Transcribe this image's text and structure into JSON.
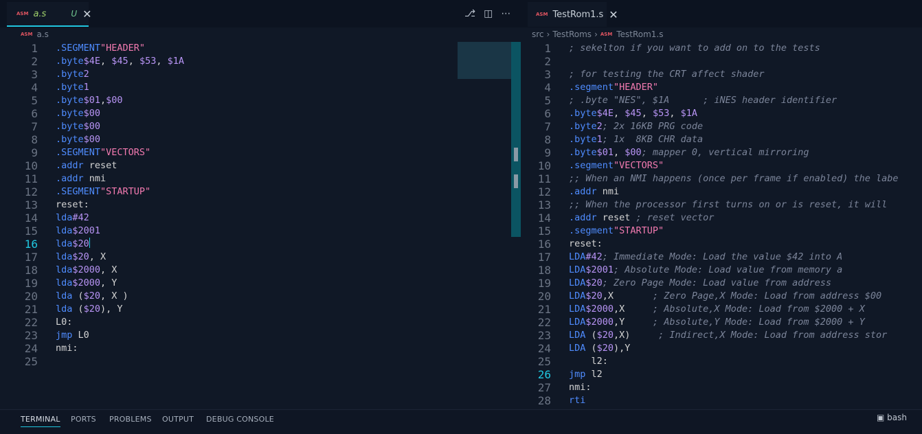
{
  "left_editor": {
    "tab": {
      "icon": "ASM",
      "filename": "a.s",
      "status": "U"
    },
    "breadcrumb": {
      "icon": "ASM",
      "file": "a.s"
    },
    "current_line": 16,
    "lines": [
      {
        "n": "1",
        "t": ".SEGMENT \"HEADER\""
      },
      {
        "n": "2",
        "t": "       .byte $4E, $45, $53, $1A"
      },
      {
        "n": "3",
        "t": "       .byte 2"
      },
      {
        "n": "4",
        "t": "       .byte 1"
      },
      {
        "n": "5",
        "t": "       .byte $01,$00"
      },
      {
        "n": "6",
        "t": "       .byte $00"
      },
      {
        "n": "7",
        "t": "       .byte $00"
      },
      {
        "n": "8",
        "t": "       .byte $00"
      },
      {
        "n": "9",
        "t": ".SEGMENT \"VECTORS\""
      },
      {
        "n": "10",
        "t": ".addr reset"
      },
      {
        "n": "11",
        "t": ".addr nmi"
      },
      {
        "n": "12",
        "t": ".SEGMENT \"STARTUP\""
      },
      {
        "n": "13",
        "t": "reset:"
      },
      {
        "n": "14",
        "t": "lda #42"
      },
      {
        "n": "15",
        "t": "lda $2001"
      },
      {
        "n": "16",
        "t": "lda $20"
      },
      {
        "n": "17",
        "t": "lda $20, X"
      },
      {
        "n": "18",
        "t": "lda $2000, X"
      },
      {
        "n": "19",
        "t": "lda $2000, Y"
      },
      {
        "n": "20",
        "t": "lda ($20, X )"
      },
      {
        "n": "21",
        "t": "lda ($20), Y"
      },
      {
        "n": "22",
        "t": "L0:"
      },
      {
        "n": "23",
        "t": "jmp L0"
      },
      {
        "n": "24",
        "t": "nmi:"
      },
      {
        "n": "25",
        "t": ""
      }
    ]
  },
  "right_editor": {
    "tab": {
      "icon": "ASM",
      "filename": "TestRom1.s"
    },
    "breadcrumb": {
      "parts": [
        "src",
        "TestRoms"
      ],
      "icon": "ASM",
      "file": "TestRom1.s"
    },
    "current_line": 26,
    "lines": [
      {
        "n": "1",
        "t": "; sekelton if you want to add on to the tests"
      },
      {
        "n": "2",
        "t": ""
      },
      {
        "n": "3",
        "t": "; for testing the CRT affect shader"
      },
      {
        "n": "4",
        "t": ".segment \"HEADER\""
      },
      {
        "n": "5",
        "t": "  ; .byte \"NES\", $1A      ; iNES header identifier"
      },
      {
        "n": "6",
        "t": "  .byte $4E, $45, $53, $1A"
      },
      {
        "n": "7",
        "t": "  .byte 2               ; 2x 16KB PRG code"
      },
      {
        "n": "8",
        "t": "  .byte 1               ; 1x  8KB CHR data"
      },
      {
        "n": "9",
        "t": "  .byte $01, $00        ; mapper 0, vertical mirroring"
      },
      {
        "n": "10",
        "t": ".segment \"VECTORS\""
      },
      {
        "n": "11",
        "t": "  ;; When an NMI happens (once per frame if enabled) the labe"
      },
      {
        "n": "12",
        "t": "    .addr nmi"
      },
      {
        "n": "13",
        "t": "    ;; When the processor first turns on or is reset, it will"
      },
      {
        "n": "14",
        "t": "    .addr reset ; reset vector"
      },
      {
        "n": "15",
        "t": ".segment \"STARTUP\""
      },
      {
        "n": "16",
        "t": "reset:"
      },
      {
        "n": "17",
        "t": "  LDA #42        ; Immediate Mode: Load the value $42 into A"
      },
      {
        "n": "18",
        "t": "    LDA $2001       ; Absolute Mode: Load value from memory a"
      },
      {
        "n": "19",
        "t": "    LDA $20         ; Zero Page Mode: Load value from address"
      },
      {
        "n": "20",
        "t": "    LDA $20,X       ; Zero Page,X Mode: Load from address $00"
      },
      {
        "n": "21",
        "t": "    LDA $2000,X     ; Absolute,X Mode: Load from $2000 + X"
      },
      {
        "n": "22",
        "t": "    LDA $2000,Y     ; Absolute,Y Mode: Load from $2000 + Y"
      },
      {
        "n": "23",
        "t": "    LDA ($20,X)     ; Indirect,X Mode: Load from address stor"
      },
      {
        "n": "24",
        "t": "    LDA ($20),Y"
      },
      {
        "n": "25",
        "t": "    l2:"
      },
      {
        "n": "26",
        "t": "      jmp l2"
      },
      {
        "n": "27",
        "t": "nmi:"
      },
      {
        "n": "28",
        "t": "    rti"
      }
    ]
  },
  "toolbar_icons": [
    "source-control-icon",
    "split-editor-icon",
    "more-icon"
  ],
  "panel": {
    "tabs": [
      "TERMINAL",
      "PORTS",
      "PROBLEMS",
      "OUTPUT",
      "DEBUG CONSOLE"
    ],
    "active": "TERMINAL",
    "shell": "bash"
  },
  "colors": {
    "accent": "#21c7e0",
    "keyword": "#4f8cff",
    "string": "#f27ab0",
    "number": "#b894f5",
    "comment": "#7b8499"
  }
}
